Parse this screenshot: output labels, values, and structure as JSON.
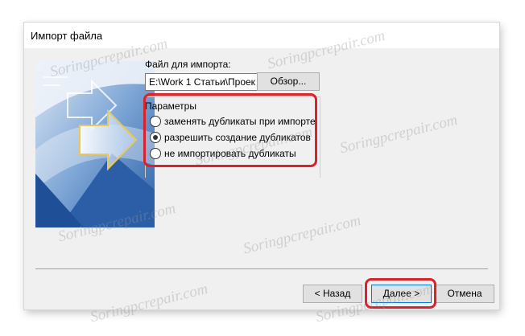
{
  "dialog": {
    "title": "Импорт файла",
    "file_label": "Файл для импорта:",
    "path_value": "E:\\Work 1 Статьи\\Проек",
    "browse_label": "Обзор...",
    "options": {
      "title": "Параметры",
      "items": [
        {
          "label": "заменять дубликаты при импорте",
          "checked": false
        },
        {
          "label": "разрешить создание дубликатов",
          "checked": true
        },
        {
          "label": "не импортировать дубликаты",
          "checked": false
        }
      ]
    },
    "buttons": {
      "back": "< Назад",
      "next": "Далее >",
      "cancel": "Отмена"
    }
  },
  "watermark": "Soringpcrepair.com",
  "colors": {
    "highlight": "#d8232a",
    "art_blue": "#2e67ad",
    "default_button_border": "#0078d7"
  },
  "icons": [
    "wizard-art-arrows",
    "radio-unchecked",
    "radio-checked"
  ]
}
